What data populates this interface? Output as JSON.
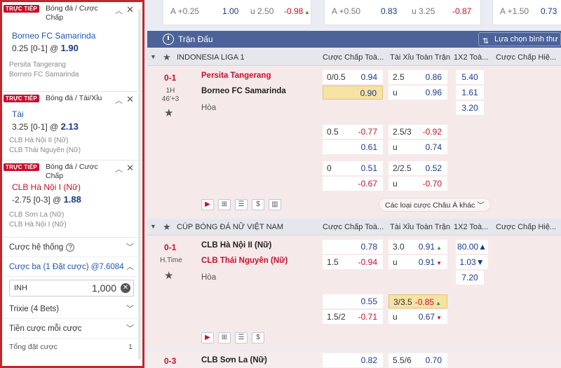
{
  "slip": {
    "bets": [
      {
        "live": "TRỰC TIẾP",
        "type": "Bóng đá / Cược Chấp",
        "selection": "Borneo FC Samarinda",
        "line": "0.25 [0-1] @",
        "odds": "1.90",
        "team_a": "Persita Tangerang",
        "team_b": "Borneo FC Samarinda"
      },
      {
        "live": "TRỰC TIẾP",
        "type": "Bóng đá / Tài/Xỉu",
        "selection": "Tài",
        "line": "3.25 [0-1] @",
        "odds": "2.13",
        "team_a": "CLB Hà Nội II (Nữ)",
        "team_b": "CLB Thái Nguyên (Nữ)"
      },
      {
        "live": "TRỰC TIẾP",
        "type": "Bóng đá / Cược Chấp",
        "selection": "CLB Hà Nội I (Nữ)",
        "line": "-2.75 [0-3] @",
        "odds": "1.88",
        "team_a": "CLB Sơn La (Nữ)",
        "team_b": "CLB Hà Nội I (Nữ)"
      }
    ],
    "system_label": "Cược hệ thống",
    "help_icon": "?",
    "triple_label": "Cược ba (1 Đặt cược) @7.6084",
    "stake_currency": "INH",
    "stake_amount": "1,000",
    "trixie_label": "Trixie (4 Bets)",
    "each_stake_label": "Tiền cược mỗi cược",
    "total_label": "Tổng đặt cược",
    "total_value": "1"
  },
  "topstrip": {
    "card1": {
      "a": "A +0.25",
      "b": "1.00",
      "c": "u 2.50",
      "d": "-0.98"
    },
    "card2": {
      "a": "A +0.50",
      "b": "0.83",
      "c": "u 3.25",
      "d": "-0.87"
    },
    "card3": {
      "a": "A +1.50",
      "b": "0.73"
    }
  },
  "main": {
    "title": "Trận Đấu",
    "filter": "Lựa chọn bình thư",
    "columns": {
      "hdp": "Cược Chấp Toà...",
      "ou": "Tài Xỉu Toàn Trận",
      "x12": "1X2 Toà...",
      "hdp_h": "Cược Chấp Hiệ..."
    },
    "league1": "INDONESIA LIGA 1",
    "league2": "CÚP BÓNG ĐÁ NỮ VIỆT NAM",
    "match1": {
      "score": "0-1",
      "period": "1H",
      "minute": "46'+3",
      "home": "Persita Tangerang",
      "away": "Borneo FC Samarinda",
      "draw": "Hòa",
      "r1": {
        "hdp_l": "0/0.5",
        "hdp_h": "0.94",
        "ou_l": "2.5",
        "ou_h": "0.86",
        "x1": "5.40"
      },
      "r2": {
        "hdp_a": "0.90",
        "ou_l": "u",
        "ou_a": "0.96",
        "x2": "1.61"
      },
      "r3": {
        "xd": "3.20"
      },
      "r4": {
        "hdp_l": "0.5",
        "hdp_h": "-0.77",
        "ou_l": "2.5/3",
        "ou_h": "-0.92"
      },
      "r5": {
        "hdp_a": "0.61",
        "ou_l": "u",
        "ou_a": "0.74"
      },
      "r6": {
        "hdp_l": "0",
        "hdp_h": "0.51",
        "ou_l": "2/2.5",
        "ou_h": "0.52"
      },
      "r7": {
        "hdp_a": "-0.67",
        "ou_l": "u",
        "ou_a": "-0.70"
      },
      "more": "Các loại cược Châu Á khác"
    },
    "match2": {
      "score": "0-1",
      "period": "H.Time",
      "home": "CLB Hà Nội II (Nữ)",
      "away": "CLB Thái Nguyên (Nữ)",
      "draw": "Hòa",
      "r1": {
        "hdp_h": "0.78",
        "ou_l": "3.0",
        "ou_h": "0.91",
        "x1": "80.00"
      },
      "r2": {
        "hdp_l": "1.5",
        "hdp_a": "-0.94",
        "ou_l": "u",
        "ou_a": "0.91",
        "x2": "1.03"
      },
      "r3": {
        "xd": "7.20"
      },
      "r4": {
        "hdp_h": "0.55",
        "ou_l": "3/3.5",
        "ou_h": "-0.85"
      },
      "r5": {
        "hdp_l": "1.5/2",
        "hdp_a": "-0.71",
        "ou_l": "u",
        "ou_a": "0.67"
      }
    },
    "match3": {
      "score": "0-3",
      "home": "CLB Sơn La (Nữ)",
      "hdp_h": "0.82",
      "ou_l": "5.5/6",
      "ou_h": "0.70"
    }
  }
}
